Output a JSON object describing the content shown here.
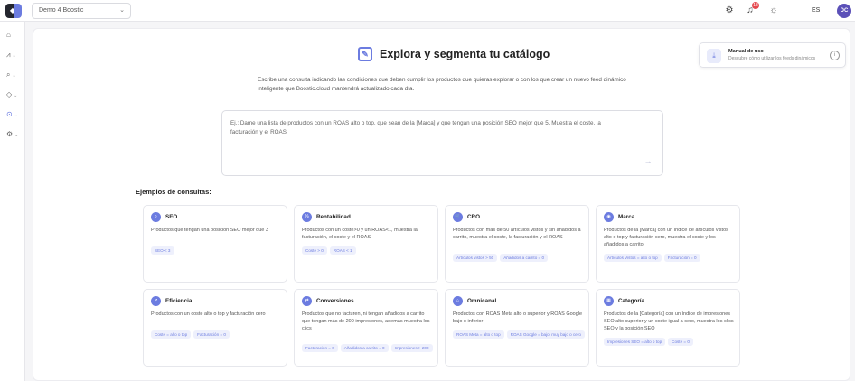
{
  "topbar": {
    "logo_text": "◆",
    "workspace_select": "Demo 4 Boostic",
    "icons": [
      "settings-icon",
      "bell-icon",
      "lightbulb-icon"
    ],
    "notification_count": "13",
    "language": "ES",
    "avatar_initials": "DC"
  },
  "sidebar": {
    "items": [
      {
        "icon": "home-icon",
        "glyph": "⌂",
        "caret": ""
      },
      {
        "icon": "analytics-icon",
        "glyph": "⩘",
        "caret": "⌄"
      },
      {
        "icon": "search-icon",
        "glyph": "⌕",
        "caret": "⌄"
      },
      {
        "icon": "tag-icon",
        "glyph": "◇",
        "caret": "⌄"
      },
      {
        "icon": "dynamic-feed-icon",
        "glyph": "⊙",
        "caret": "⌄"
      },
      {
        "icon": "settings-icon",
        "glyph": "⚙",
        "caret": "⌄"
      }
    ],
    "active_index": 4
  },
  "main": {
    "title": "Explora y segmenta tu catálogo",
    "description": "Escribe una consulta indicando las condiciones que deben cumplir los productos que quieras explorar o con los que crear un nuevo feed dinámico inteligente que Boostic.cloud mantendrá actualizado cada día.",
    "prompt_placeholder": "Ej.: Dame una lista de productos con un ROAS alto o top, que sean de la [Marca] y que tengan una posición SEO mejor que 5. Muestra el coste, la facturación y el ROAS",
    "examples_label": "Ejemplos de consultas:"
  },
  "manual": {
    "title": "Manual de uso",
    "subtitle": "Descubre cómo utilizar los feeds dinámicos"
  },
  "cards": [
    {
      "title": "SEO",
      "icon": "search-icon",
      "glyph": "⌕",
      "body": "Productos que tengan una posición SEO mejor que 3",
      "tags": [
        "SEO < 3"
      ]
    },
    {
      "title": "Rentabilidad",
      "icon": "percent-icon",
      "glyph": "%",
      "body": "Productos con un coste>0 y un ROAS<1, muestra la facturación, el coste y el ROAS",
      "tags": [
        "Coste > 0",
        "ROAS < 1"
      ]
    },
    {
      "title": "CRO",
      "icon": "cart-icon",
      "glyph": "🛒",
      "body": "Productos con más de 50 artículos vistos y sin añadidos a carrito, muestra el coste, la facturación y el ROAS",
      "tags": [
        "Artículos vistos > 50",
        "Añadidos a carrito = 0"
      ]
    },
    {
      "title": "Marca",
      "icon": "brand-icon",
      "glyph": "◉",
      "body": "Productos de la [Marca] con un índice de artículos vistos alto o top y facturación cero, muestra el coste y los añadidos a carrito",
      "tags": [
        "Artículos Vistos = alto o top",
        "Facturación = 0"
      ]
    },
    {
      "title": "Eficiencia",
      "icon": "efficiency-icon",
      "glyph": "↗",
      "body": "Productos con un coste alto o top y facturación cero",
      "tags": [
        "Coste = alto o top",
        "Facturación = 0"
      ]
    },
    {
      "title": "Conversiones",
      "icon": "conversions-icon",
      "glyph": "⇄",
      "body": "Productos que no facturen, ni tengan añadidos a carrito que tengan más de 200 impresiones, además muestra los clics",
      "tags": [
        "Facturación = 0",
        "Añadidos a carrito = 0",
        "Impresiones > 200"
      ]
    },
    {
      "title": "Omnicanal",
      "icon": "omnichannel-icon",
      "glyph": "⌂",
      "body": "Productos con ROAS Meta alto o superior y ROAS Google bajo o inferior",
      "tags": [
        "ROAS Meta = alto o top",
        "ROAS Google = bajo, muy bajo o cero"
      ]
    },
    {
      "title": "Categoría",
      "icon": "category-icon",
      "glyph": "▦",
      "body": "Productos de la [Categoría] con un índice de impresiones SEO alto superior y un coste igual a cero, muestra los clics SEO y la posición SEO",
      "tags": [
        "Impresiones SEO = alto o top",
        "Coste = 0"
      ]
    }
  ],
  "colors": {
    "accent": "#6c7ce0",
    "avatar": "#5b50b8",
    "badge": "#e5484d"
  }
}
